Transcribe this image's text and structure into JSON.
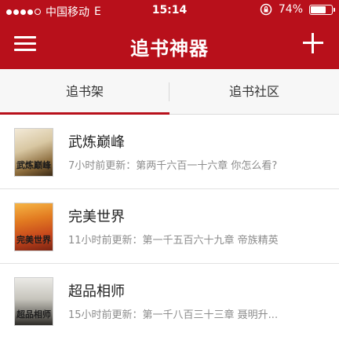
{
  "status_bar": {
    "carrier": "中国移动",
    "network": "E",
    "time": "15:14",
    "battery": "74%",
    "battery_level": 0.74
  },
  "navbar": {
    "title": "追书神器"
  },
  "tabs": [
    {
      "label": "追书架",
      "active": true
    },
    {
      "label": "追书社区",
      "active": false
    }
  ],
  "books": [
    {
      "title": "武炼巅峰",
      "meta": "7小时前更新：第两千六百一十六章 你怎么看?",
      "cover_text": "武炼巅峰"
    },
    {
      "title": "完美世界",
      "meta": "11小时前更新：第一千五百六十九章 帝族精英",
      "cover_text": "完美世界"
    },
    {
      "title": "超品相师",
      "meta": "15小时前更新：第一千八百三十三章 聂明升...",
      "cover_text": "超品相师"
    }
  ],
  "colors": {
    "header": "#b8101b",
    "tab_indicator": "#b8101b"
  }
}
